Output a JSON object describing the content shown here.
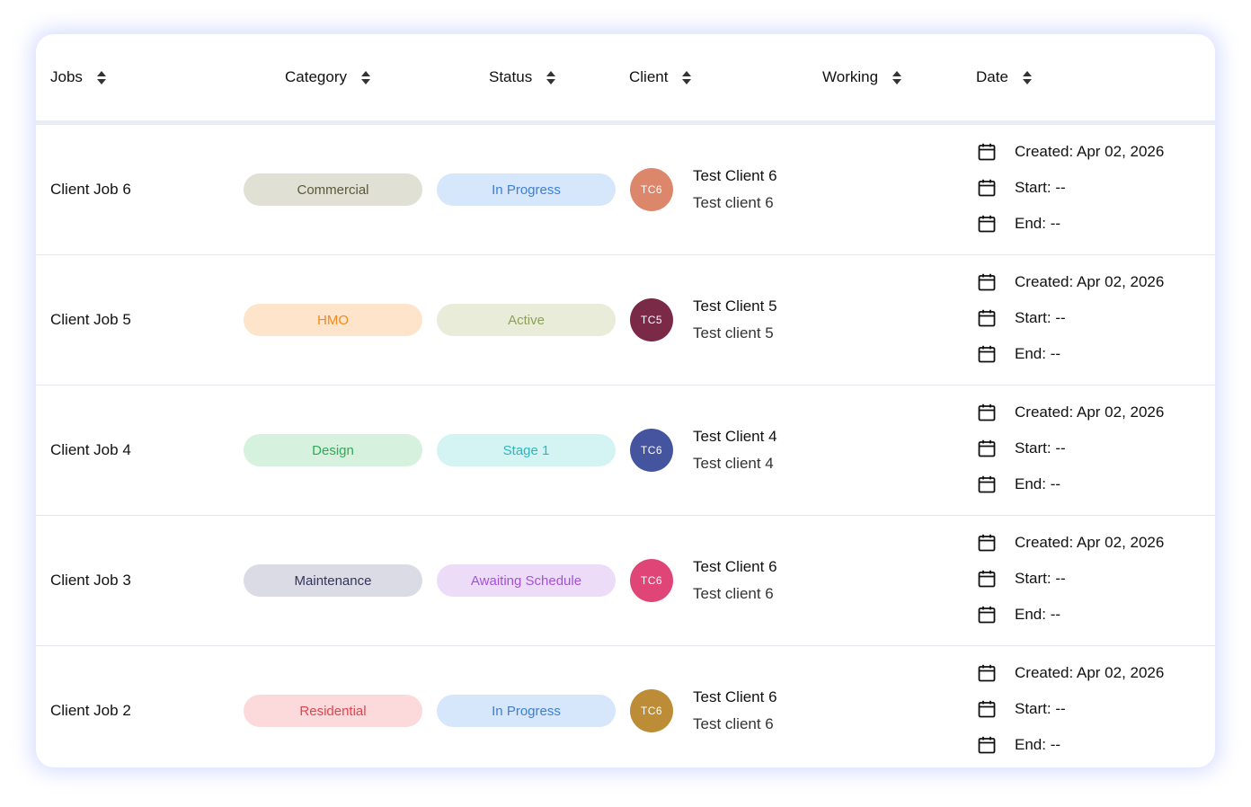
{
  "header": {
    "jobs": "Jobs",
    "category": "Category",
    "status": "Status",
    "client": "Client",
    "working": "Working",
    "date": "Date"
  },
  "rows": [
    {
      "job": "Client Job 6",
      "category": {
        "label": "Commercial",
        "bg": "#e0e0d4",
        "fg": "#5a5a3a"
      },
      "status": {
        "label": "In Progress",
        "bg": "#d6e6fb",
        "fg": "#3b7fd9"
      },
      "avatar": {
        "initials": "TC6",
        "color": "#dc876c"
      },
      "client_name": "Test Client 6",
      "client_sub": "Test client 6",
      "created": "Created: Apr 02, 2026",
      "start": "Start: --",
      "end": "End: --"
    },
    {
      "job": "Client Job 5",
      "category": {
        "label": "HMO",
        "bg": "#ffe4cc",
        "fg": "#f08a1a"
      },
      "status": {
        "label": "Active",
        "bg": "#e8ecd9",
        "fg": "#8da05a"
      },
      "avatar": {
        "initials": "TC5",
        "color": "#7a2a46"
      },
      "client_name": "Test Client 5",
      "client_sub": "Test client 5",
      "created": "Created: Apr 02, 2026",
      "start": "Start: --",
      "end": "End: --"
    },
    {
      "job": "Client Job 4",
      "category": {
        "label": "Design",
        "bg": "#d6f1de",
        "fg": "#2fab55"
      },
      "status": {
        "label": "Stage 1",
        "bg": "#d4f4f4",
        "fg": "#2ab8be"
      },
      "avatar": {
        "initials": "TC6",
        "color": "#45549e"
      },
      "client_name": "Test Client 4",
      "client_sub": "Test client 4",
      "created": "Created: Apr 02, 2026",
      "start": "Start: --",
      "end": "End: --"
    },
    {
      "job": "Client Job 3",
      "category": {
        "label": "Maintenance",
        "bg": "#dadbe4",
        "fg": "#33355a"
      },
      "status": {
        "label": "Awaiting Schedule",
        "bg": "#eddcf7",
        "fg": "#a352d8"
      },
      "avatar": {
        "initials": "TC6",
        "color": "#df4577"
      },
      "client_name": "Test Client 6",
      "client_sub": "Test client 6",
      "created": "Created: Apr 02, 2026",
      "start": "Start: --",
      "end": "End: --"
    },
    {
      "job": "Client Job 2",
      "category": {
        "label": "Residential",
        "bg": "#fcdadc",
        "fg": "#e0444c"
      },
      "status": {
        "label": "In Progress",
        "bg": "#d6e6fb",
        "fg": "#3b7fd9"
      },
      "avatar": {
        "initials": "TC6",
        "color": "#bd8c37"
      },
      "client_name": "Test Client 6",
      "client_sub": "Test client 6",
      "created": "Created: Apr 02, 2026",
      "start": "Start: --",
      "end": "End: --"
    }
  ],
  "icons": {
    "sort": "sort-icon",
    "calendar": "calendar-icon"
  }
}
